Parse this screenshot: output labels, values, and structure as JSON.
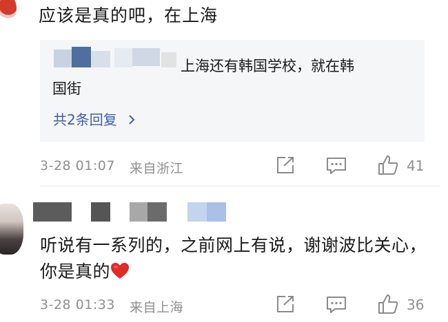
{
  "comment1": {
    "text": "应该是真的吧，在上海",
    "reply": {
      "line1": "上海还有韩国学校，就在韩",
      "line2": "国街",
      "more": "共2条回复"
    },
    "time": "3-28 01:07",
    "location": "来自浙江",
    "likes": "41"
  },
  "comment2": {
    "text": "听说有一系列的，之前网上有说，谢谢波比关心，你是真的",
    "time": "3-28 01:33",
    "location": "来自上海",
    "likes": "36"
  },
  "colors": {
    "link": "#3c5fa3",
    "meta": "#8f8f8f",
    "reply_bg": "#f5f6f8",
    "heart": "#e02b2b"
  },
  "icons": [
    "share-icon",
    "comment-icon",
    "like-icon",
    "chevron-right-icon",
    "heart-emoji-icon"
  ]
}
